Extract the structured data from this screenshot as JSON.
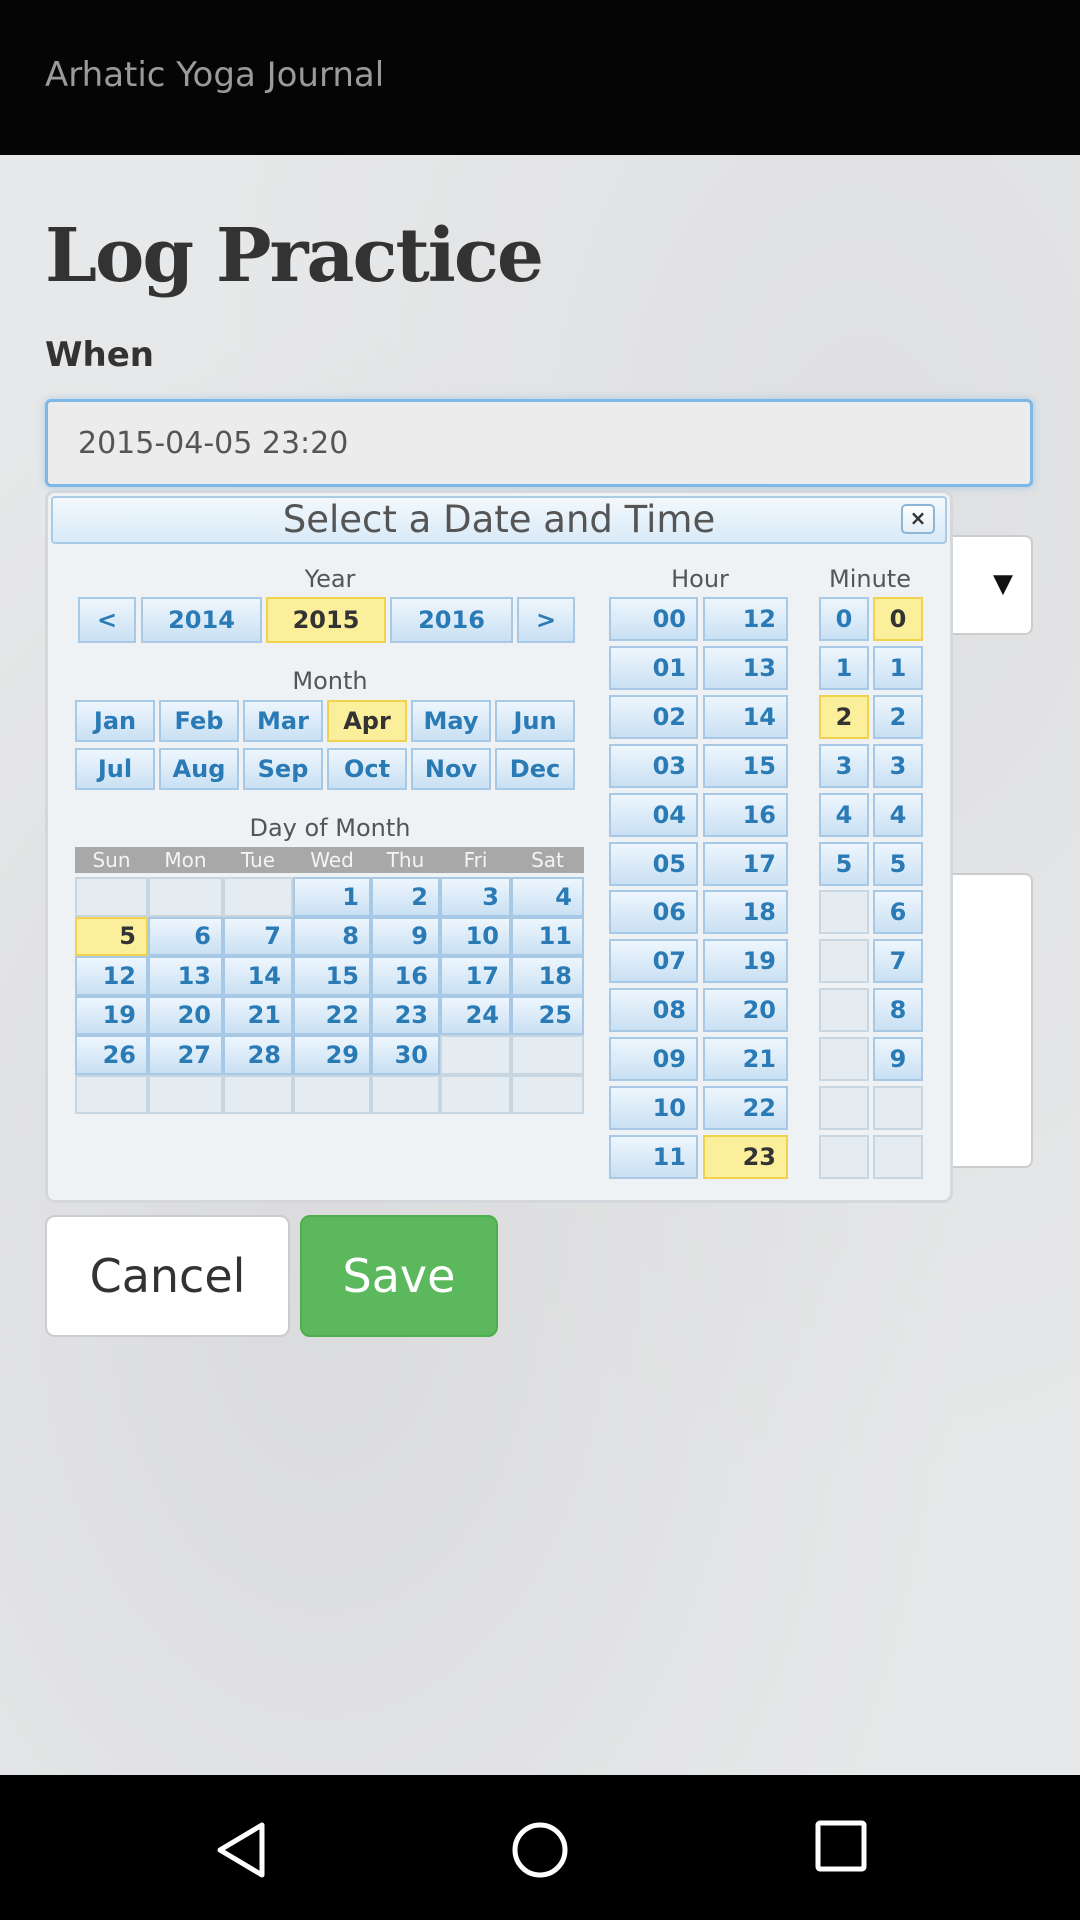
{
  "app": {
    "title": "Arhatic Yoga Journal"
  },
  "page": {
    "title": "Log Practice"
  },
  "form": {
    "when_label": "When",
    "when_value": "2015-04-05 23:20",
    "select_arrow": "▼",
    "cancel_label": "Cancel",
    "save_label": "Save"
  },
  "picker": {
    "header": "Select a Date and Time",
    "close": "×",
    "year_label": "Year",
    "years": [
      "<",
      "2014",
      "2015",
      "2016",
      ">"
    ],
    "selected_year": "2015",
    "month_label": "Month",
    "months": [
      "Jan",
      "Feb",
      "Mar",
      "Apr",
      "May",
      "Jun",
      "Jul",
      "Aug",
      "Sep",
      "Oct",
      "Nov",
      "Dec"
    ],
    "selected_month": "Apr",
    "day_label": "Day of Month",
    "weekdays": [
      "Sun",
      "Mon",
      "Tue",
      "Wed",
      "Thu",
      "Fri",
      "Sat"
    ],
    "days": [
      [
        "",
        "",
        "",
        "1",
        "2",
        "3",
        "4"
      ],
      [
        "5",
        "6",
        "7",
        "8",
        "9",
        "10",
        "11"
      ],
      [
        "12",
        "13",
        "14",
        "15",
        "16",
        "17",
        "18"
      ],
      [
        "19",
        "20",
        "21",
        "22",
        "23",
        "24",
        "25"
      ],
      [
        "26",
        "27",
        "28",
        "29",
        "30",
        "",
        ""
      ],
      [
        "",
        "",
        "",
        "",
        "",
        "",
        ""
      ]
    ],
    "selected_day": "5",
    "hour_label": "Hour",
    "hours_left": [
      "00",
      "01",
      "02",
      "03",
      "04",
      "05",
      "06",
      "07",
      "08",
      "09",
      "10",
      "11"
    ],
    "hours_right": [
      "12",
      "13",
      "14",
      "15",
      "16",
      "17",
      "18",
      "19",
      "20",
      "21",
      "22",
      "23"
    ],
    "selected_hour": "23",
    "minute_label": "Minute",
    "minute_tens": [
      "0",
      "1",
      "2",
      "3",
      "4",
      "5",
      "",
      "",
      "",
      "",
      "",
      ""
    ],
    "minute_ones": [
      "0",
      "1",
      "2",
      "3",
      "4",
      "5",
      "6",
      "7",
      "8",
      "9",
      "",
      ""
    ],
    "selected_minute_tens": "2",
    "selected_minute_ones": "0"
  },
  "icons": {
    "back": "back-triangle-icon",
    "home": "home-circle-icon",
    "recents": "recents-square-icon"
  },
  "colors": {
    "selected": "#fcef9b",
    "save": "#5cb85c",
    "link": "#2a7ab5"
  }
}
